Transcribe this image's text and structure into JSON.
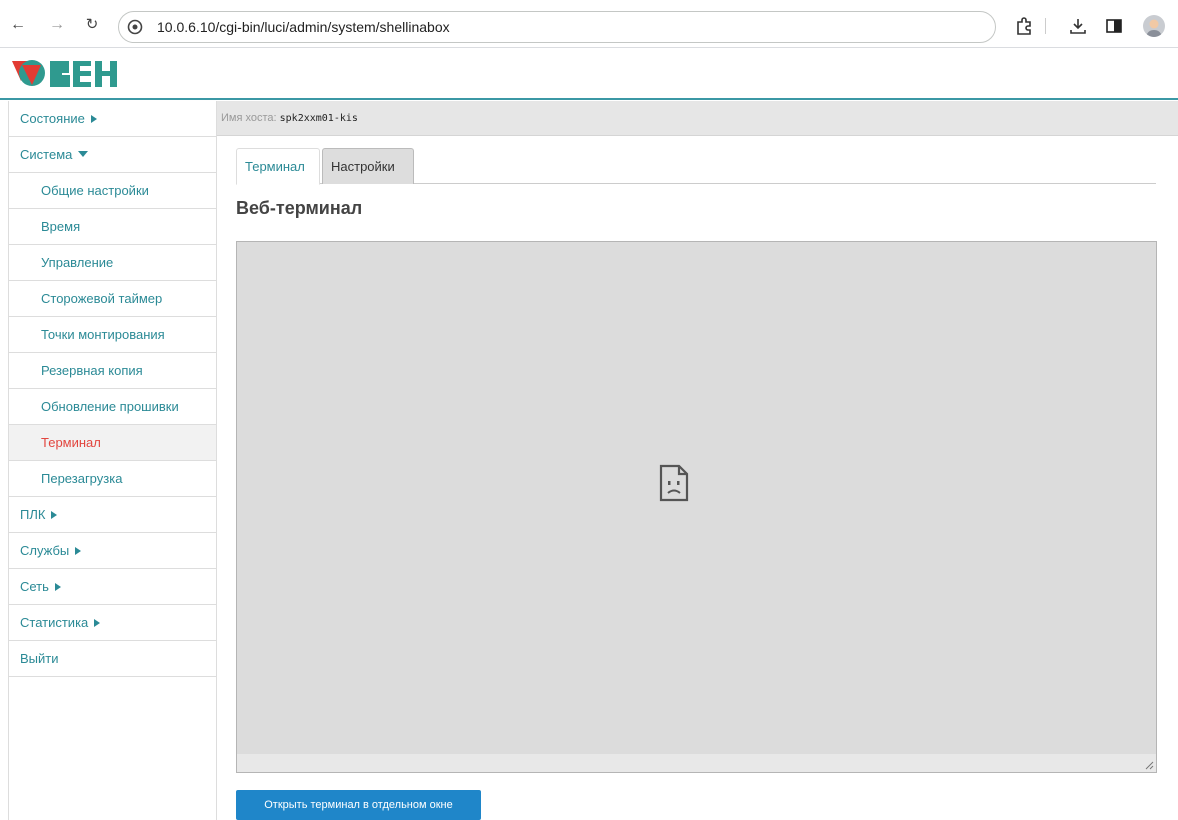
{
  "browser": {
    "url": "10.0.6.10/cgi-bin/luci/admin/system/shellinabox"
  },
  "brand": {
    "accent_color": "#3b98a5",
    "logo_name": "owen-logo"
  },
  "sidebar": {
    "items": [
      {
        "label": "Состояние",
        "level": 0,
        "expander": "right"
      },
      {
        "label": "Система",
        "level": 0,
        "expander": "down"
      },
      {
        "label": "Общие настройки",
        "level": 1
      },
      {
        "label": "Время",
        "level": 1
      },
      {
        "label": "Управление",
        "level": 1
      },
      {
        "label": "Сторожевой таймер",
        "level": 1
      },
      {
        "label": "Точки монтирования",
        "level": 1
      },
      {
        "label": "Резервная копия",
        "level": 1
      },
      {
        "label": "Обновление прошивки",
        "level": 1
      },
      {
        "label": "Терминал",
        "level": 1,
        "active": true
      },
      {
        "label": "Перезагрузка",
        "level": 1
      },
      {
        "label": "ПЛК",
        "level": 0,
        "expander": "right"
      },
      {
        "label": "Службы",
        "level": 0,
        "expander": "right"
      },
      {
        "label": "Сеть",
        "level": 0,
        "expander": "right"
      },
      {
        "label": "Статистика",
        "level": 0,
        "expander": "right"
      },
      {
        "label": "Выйти",
        "level": 0
      }
    ]
  },
  "hostbar": {
    "label": "Имя хоста:",
    "value": "spk2xxm01-kis"
  },
  "tabs": [
    {
      "label": "Терминал",
      "active": true
    },
    {
      "label": "Настройки",
      "active": false
    }
  ],
  "main": {
    "title": "Веб-терминал",
    "open_button_label": "Открыть терминал в отдельном окне",
    "frame_icon": "sad-page-icon"
  }
}
